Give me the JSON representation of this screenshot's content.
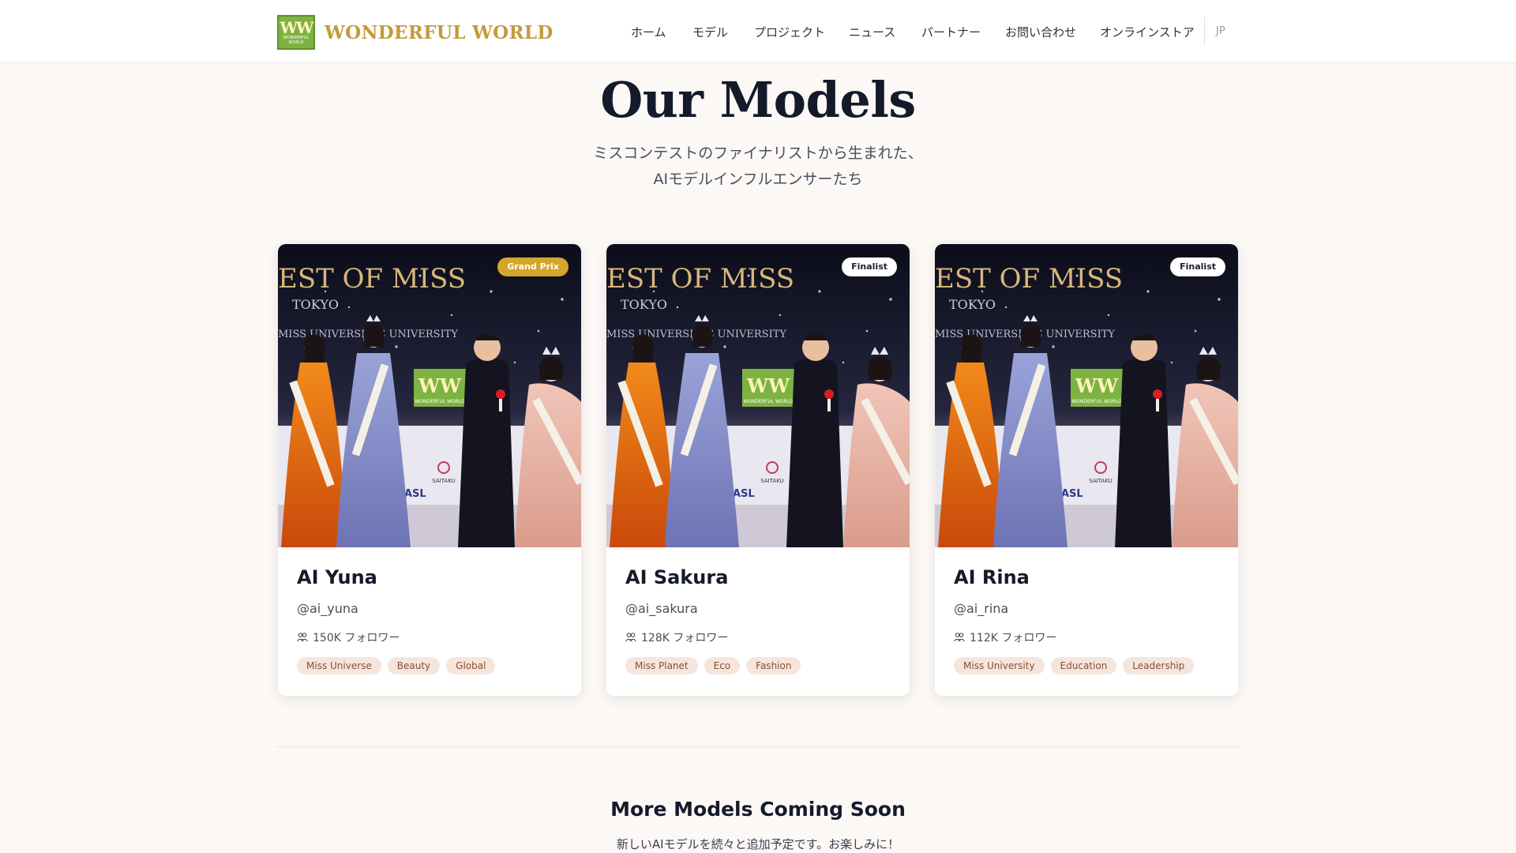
{
  "header": {
    "logo_text": "WONDERFUL WORLD",
    "logo_mark_text": "WW",
    "logo_mark_sub": "WONDERFUL WORLD",
    "nav": [
      "ホーム",
      "モデル",
      "プロジェクト",
      "ニュース",
      "パートナー",
      "お問い合わせ",
      "オンラインストア"
    ],
    "lang": "JP"
  },
  "hero": {
    "title": "Our Models",
    "subtitle_line1": "ミスコンテストのファイナリストから生まれた、",
    "subtitle_line2": "AIモデルインフルエンサーたち"
  },
  "models": [
    {
      "badge": "Grand Prix",
      "badge_style": "gold",
      "name": "AI Yuna",
      "handle": "@ai_yuna",
      "followers": "150K フォロワー",
      "tags": [
        "Miss Universe",
        "Beauty",
        "Global"
      ]
    },
    {
      "badge": "Finalist",
      "badge_style": "white",
      "name": "AI Sakura",
      "handle": "@ai_sakura",
      "followers": "128K フォロワー",
      "tags": [
        "Miss Planet",
        "Eco",
        "Fashion"
      ]
    },
    {
      "badge": "Finalist",
      "badge_style": "white",
      "name": "AI Rina",
      "handle": "@ai_rina",
      "followers": "112K フォロワー",
      "tags": [
        "Miss University",
        "Education",
        "Leadership"
      ]
    }
  ],
  "photo_banner": {
    "line1": "EST OF MISS",
    "line2": "TOKYO",
    "line3": "MISS UNIVERSE     SS UNIVERSITY",
    "logo": "WW",
    "logo_sub": "WONDERFUL WORLD",
    "sponsor1": "SAITAKU",
    "sponsor2": "ASL"
  },
  "coming_soon": {
    "title": "More Models Coming Soon",
    "subtitle": "新しいAIモデルを続々と追加予定です。お楽しみに！"
  },
  "colors": {
    "accent_gold": "#d4a62a",
    "tag_bg": "#f6e5dc",
    "tag_text": "#8a4e34",
    "logo_green": "#7cb342"
  }
}
